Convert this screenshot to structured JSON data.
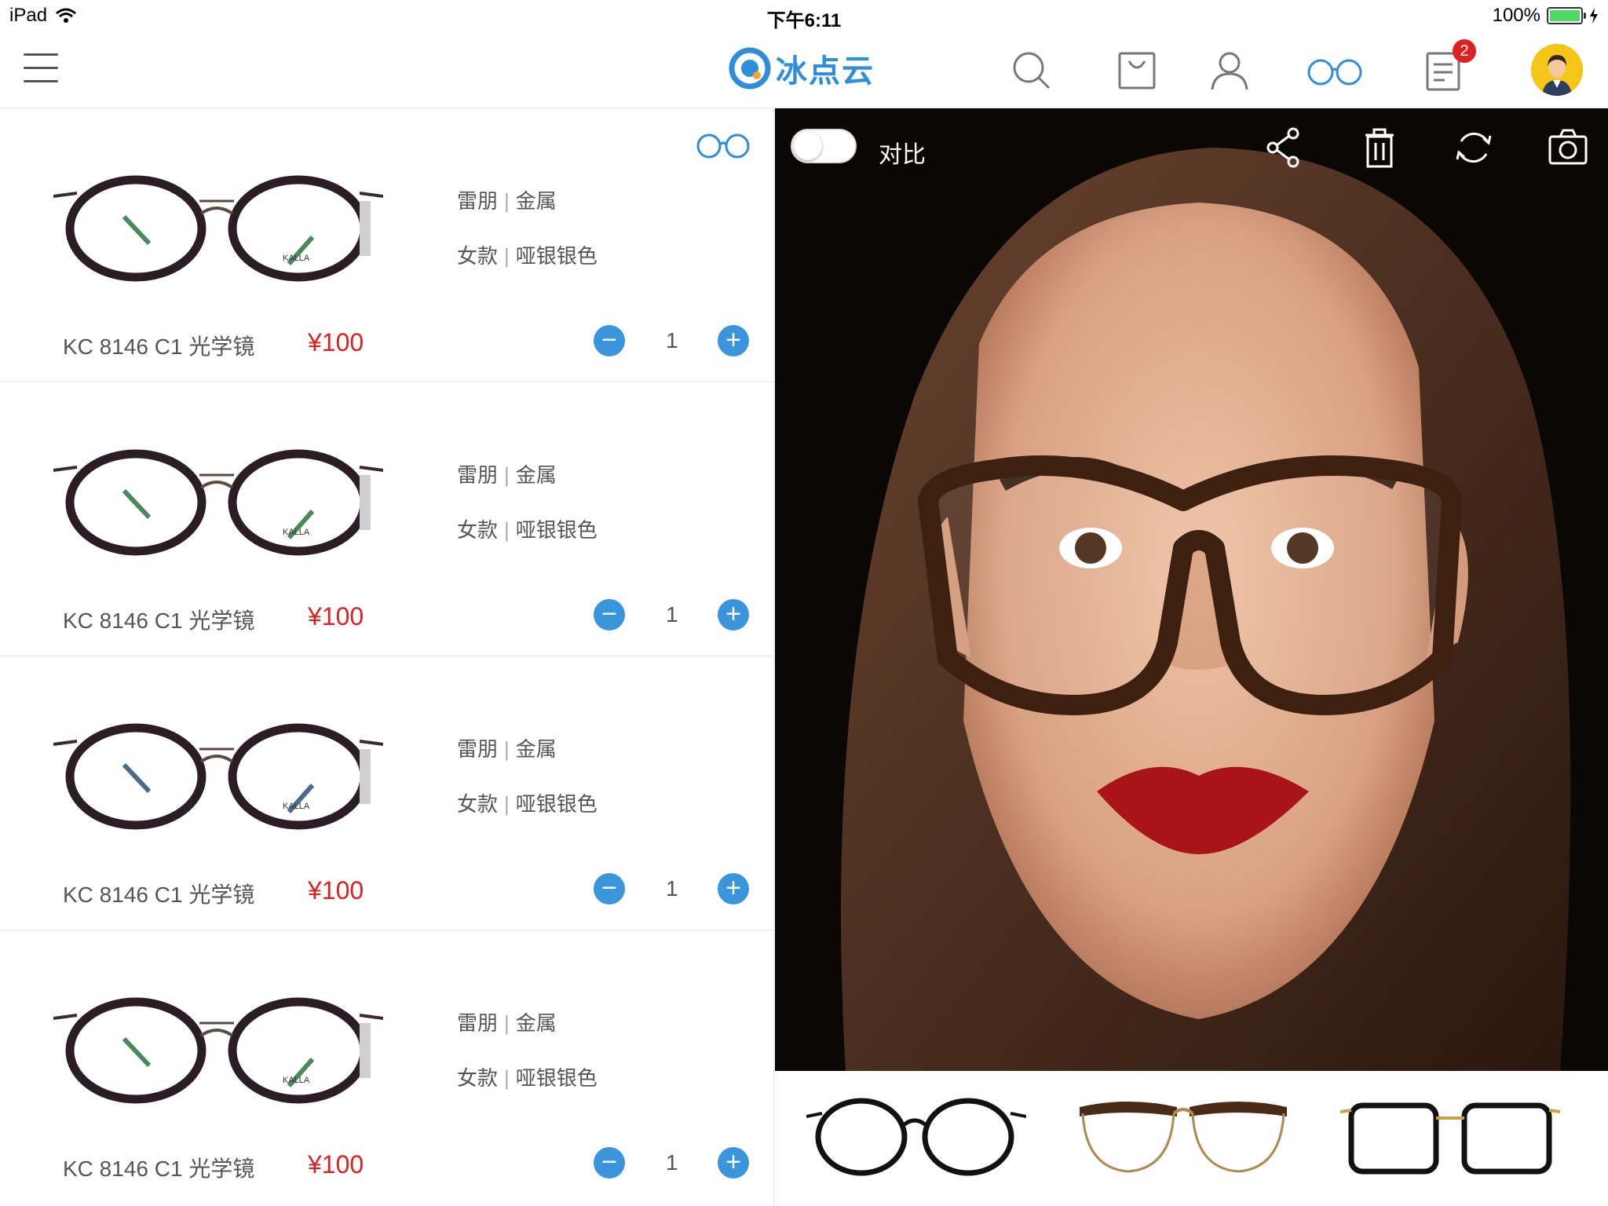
{
  "status_bar": {
    "device": "iPad",
    "time": "下午6:11",
    "battery_percent": "100%",
    "wifi_icon": "wifi-icon",
    "battery_icon": "battery-icon"
  },
  "navbar": {
    "brand_name": "冰点云",
    "menu_icon": "menu-icon",
    "search_icon": "search-icon",
    "bag_icon": "shopping-bag-icon",
    "user_icon": "user-icon",
    "glasses_icon": "glasses-icon",
    "orders_icon": "orders-list-icon",
    "orders_badge": "2",
    "brand_color": "#2e8fd8"
  },
  "list": {
    "items": [
      {
        "attr_brand": "雷朋",
        "attr_material": "金属",
        "attr_gender": "女款",
        "attr_color": "哑银银色",
        "model": "KC 8146 C1 光学镜",
        "price": "¥100",
        "qty": "1",
        "minus": "−",
        "plus": "+"
      },
      {
        "attr_brand": "雷朋",
        "attr_material": "金属",
        "attr_gender": "女款",
        "attr_color": "哑银银色",
        "model": "KC 8146 C1 光学镜",
        "price": "¥100",
        "qty": "1",
        "minus": "−",
        "plus": "+"
      },
      {
        "attr_brand": "雷朋",
        "attr_material": "金属",
        "attr_gender": "女款",
        "attr_color": "哑银银色",
        "model": "KC 8146 C1 光学镜",
        "price": "¥100",
        "qty": "1",
        "minus": "−",
        "plus": "+"
      },
      {
        "attr_brand": "雷朋",
        "attr_material": "金属",
        "attr_gender": "女款",
        "attr_color": "哑银银色",
        "model": "KC 8146 C1 光学镜",
        "price": "¥100",
        "qty": "1",
        "minus": "−",
        "plus": "+"
      }
    ],
    "frame_brand_print": "KALLA",
    "separator": "|",
    "price_color": "#e02020",
    "button_color": "#3a95dd"
  },
  "preview": {
    "compare_label": "对比",
    "compare_toggle": "off",
    "share_icon": "share-icon",
    "delete_icon": "trash-icon",
    "refresh_icon": "refresh-icon",
    "camera_icon": "camera-icon"
  },
  "thumbnails": [
    {
      "icon": "round-black-glasses-icon"
    },
    {
      "icon": "browline-tortoise-glasses-icon"
    },
    {
      "icon": "square-black-gold-glasses-icon"
    }
  ]
}
